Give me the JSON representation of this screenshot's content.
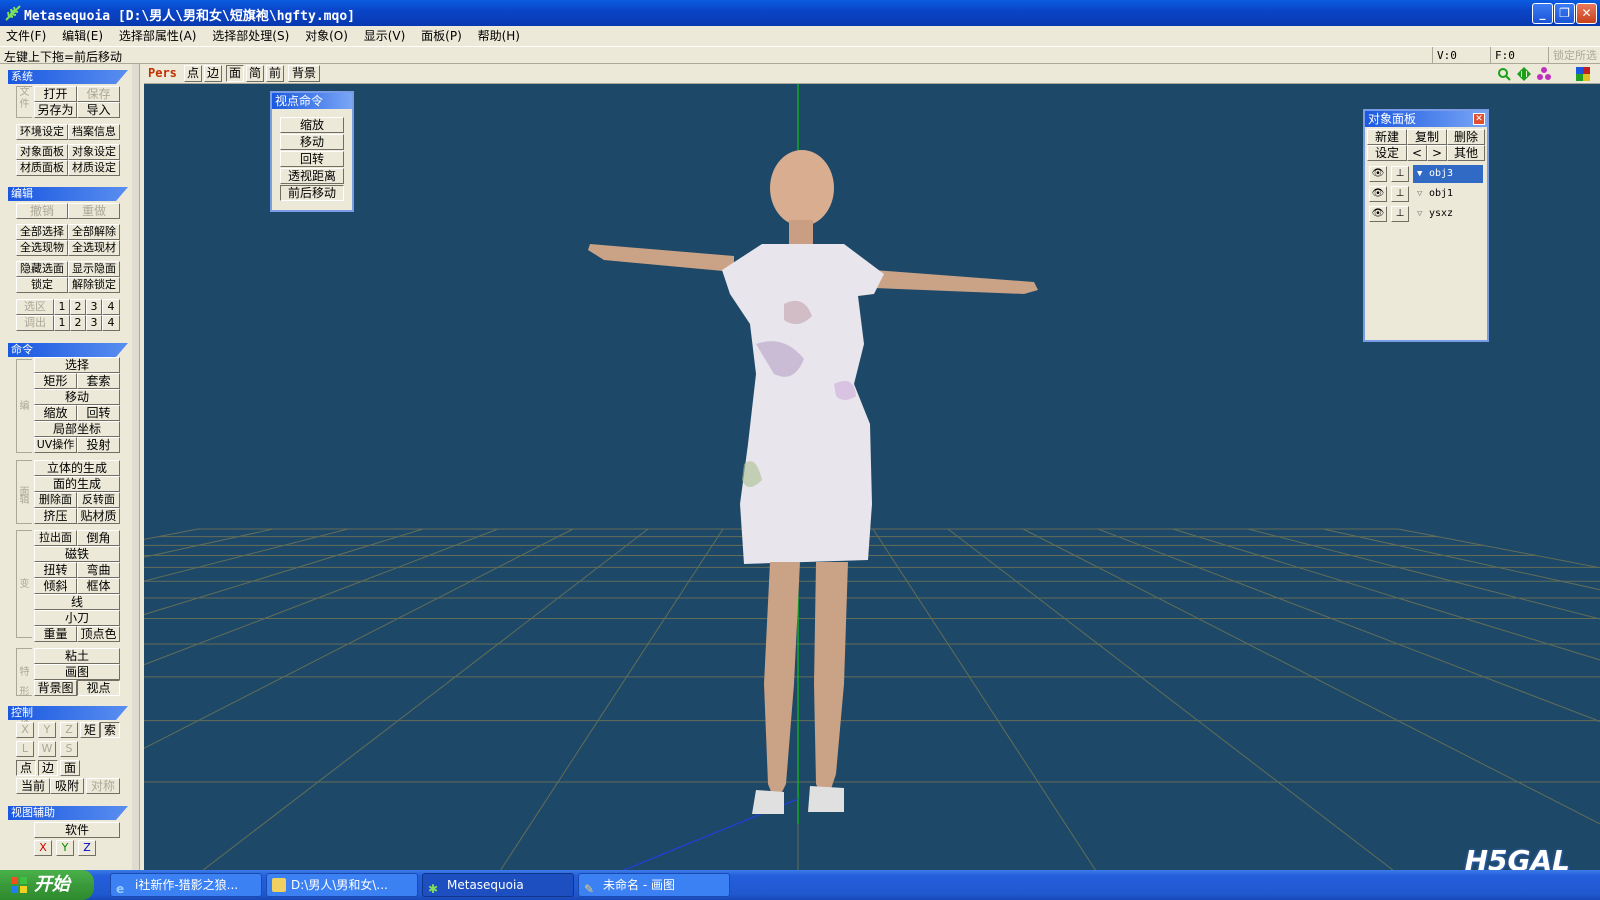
{
  "window": {
    "title": "Metasequoia [D:\\男人\\男和女\\短旗袍\\hgfty.mqo]"
  },
  "menu": [
    "文件(F)",
    "编辑(E)",
    "选择部属性(A)",
    "选择部处理(S)",
    "对象(O)",
    "显示(V)",
    "面板(P)",
    "帮助(H)"
  ],
  "status": {
    "hint": "左键上下拖=前后移动",
    "v": "V:0",
    "f": "F:0",
    "lock": "锁定所选"
  },
  "sections": {
    "system": "系统",
    "edit": "编辑",
    "command": "命令",
    "control": "控制",
    "viewaid": "视图辅助"
  },
  "system": {
    "side": "文件",
    "open": "打开",
    "save": "保存",
    "saveas": "另存为",
    "import": "导入",
    "env": "环境设定",
    "info": "档案信息",
    "objpanel": "对象面板",
    "objset": "对象设定",
    "matpanel": "材质面板",
    "matset": "材质设定"
  },
  "edit": {
    "undo": "撤销",
    "redo": "重做",
    "selall": "全部选择",
    "deselall": "全部解除",
    "selobj": "全选现物",
    "selmat": "全选现材",
    "hidesel": "隐藏选面",
    "showhide": "显示隐面",
    "lock": "锁定",
    "unlock": "解除锁定",
    "selarea": "选区",
    "recall": "调出",
    "nums": [
      "1",
      "2",
      "3",
      "4"
    ]
  },
  "command": {
    "side1": "编辑",
    "select": "选择",
    "rect": "矩形",
    "lasso": "套索",
    "move": "移动",
    "scale": "缩放",
    "rotate": "回转",
    "local": "局部坐标",
    "uv": "UV操作",
    "project": "投射",
    "side2": "面",
    "solid": "立体的生成",
    "face": "面的生成",
    "delface": "删除面",
    "flip": "反转面",
    "extrude": "挤压",
    "texmat": "贴材质",
    "side3": "变形",
    "pullface": "拉出面",
    "bevel": "倒角",
    "magnet": "磁铁",
    "twist": "扭转",
    "bend": "弯曲",
    "tilt": "倾斜",
    "lattice": "框体",
    "line": "线",
    "knife": "小刀",
    "weight": "重量",
    "vcolor": "顶点色",
    "side4": "特殊",
    "clay": "粘土",
    "paint": "画图",
    "bgimg": "背景图",
    "view": "视点"
  },
  "control": {
    "x": "X",
    "y": "Y",
    "z": "Z",
    "rect": "矩",
    "lasso": "索",
    "l": "L",
    "w": "W",
    "s": "S",
    "point": "点",
    "edge": "边",
    "face": "面",
    "current": "当前",
    "snap": "吸附",
    "sym": "对称"
  },
  "viewaid": {
    "soft": "软件"
  },
  "viewtoolbar": {
    "pers": "Pers",
    "point": "点",
    "edge": "边",
    "face": "面",
    "simple": "简",
    "front": "前",
    "bg": "背景"
  },
  "viewcmd": {
    "title": "视点命令",
    "items": [
      "缩放",
      "移动",
      "回转",
      "透视距离",
      "前后移动"
    ]
  },
  "objpanel": {
    "title": "对象面板",
    "new": "新建",
    "copy": "复制",
    "del": "删除",
    "set": "设定",
    "prev": "<",
    "next": ">",
    "other": "其他",
    "objects": [
      "obj3",
      "obj1",
      "ysxz"
    ]
  },
  "taskbar": {
    "start": "开始",
    "items": [
      "i社新作-猎影之狼...",
      "D:\\男人\\男和女\\...",
      "Metasequoia",
      "未命名 - 画图"
    ]
  },
  "watermark": "H5GAL",
  "colors": {
    "viewport": "#1d4868",
    "grid": "#8a7a4a",
    "accent": "#1a58e0"
  }
}
